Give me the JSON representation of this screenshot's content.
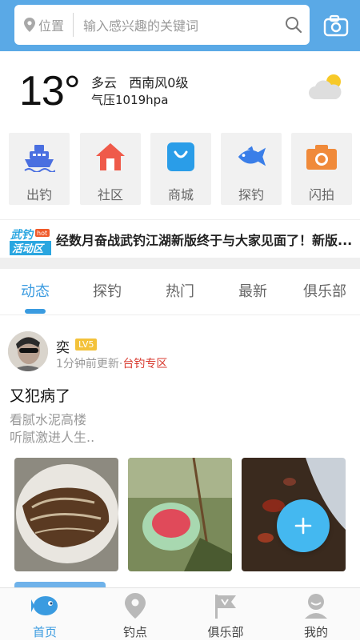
{
  "search": {
    "location_label": "位置",
    "placeholder": "输入感兴趣的关键词"
  },
  "weather": {
    "temperature": "13°",
    "condition": "多云",
    "wind": "西南风0级",
    "pressure": "气压1019hpa"
  },
  "features": [
    {
      "label": "出钓",
      "icon": "ship-icon",
      "color": "#4a6fe0"
    },
    {
      "label": "社区",
      "icon": "house-icon",
      "color": "#ef5a4a"
    },
    {
      "label": "商城",
      "icon": "shopping-bag-icon",
      "color": "#2a9de8"
    },
    {
      "label": "探钓",
      "icon": "fish-icon",
      "color": "#3a7ee8"
    },
    {
      "label": "闪拍",
      "icon": "camera-icon",
      "color": "#f08a3a"
    }
  ],
  "banner": {
    "logo_text_1": "武钓",
    "logo_badge": "hot",
    "logo_text_2": "活动区",
    "text": "经数月奋战武钓江湖新版终于与大家见面了！新版..."
  },
  "tabs": [
    "动态",
    "探钓",
    "热门",
    "最新",
    "俱乐部"
  ],
  "active_tab": "动态",
  "post": {
    "username": "奕",
    "level": "LV5",
    "time": "1分钟前更新·",
    "tag": "台钓专区",
    "title": "又犯病了",
    "body_line1": "看腻水泥高楼",
    "body_line2": "听腻激进人生.."
  },
  "bottom_nav": [
    "首页",
    "钓点",
    "俱乐部",
    "我的"
  ],
  "colors": {
    "accent": "#3a9be0",
    "topbar": "#5aa9e6",
    "tag": "#d83a2f",
    "level_badge": "#f3c23a"
  }
}
